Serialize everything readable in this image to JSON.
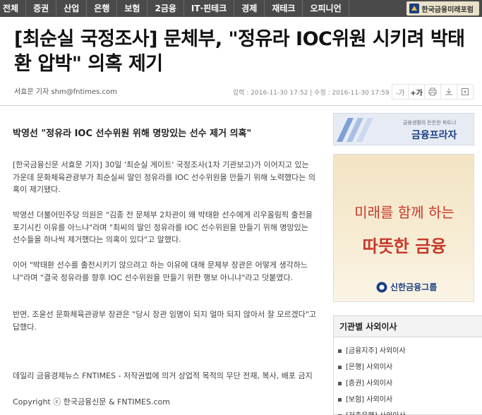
{
  "nav": {
    "items": [
      "전체",
      "증권",
      "산업",
      "은행",
      "보험",
      "2금융",
      "IT·핀테크",
      "경제",
      "재테크",
      "오피니언"
    ],
    "forum_label": "한국금융미래포럼"
  },
  "article": {
    "headline": "[최순실 국정조사] 문체부, \"정유라 IOC위원 시키려 박태환 압박\" 의혹 제기",
    "byline": "서효문 기자 shm@fntimes.com",
    "dates": "입력 : 2016-11-30 17:52  |  수정 : 2016-11-30 17:59",
    "subhead": "박영선 \"정유라 IOC 선수위원 위해 명망있는 선수 제거 의혹\"",
    "paragraphs": [
      "[한국금융신문 서효문 기자] 30일 '최순실 게이트' 국정조사(1차 기관보고)가 이어지고 있는 가운데 문화체육관광부가 최순실씨 딸인 정유라를 IOC 선수위원을 만들기 위해 노력했다는 의혹이 제기됐다.",
      "박영선 더불어민주당 의원은 \"김종 전 문체부 2차관이 왜 박태환 선수에게 리우올림픽 출전을 포기시킨 이유를 아느냐\"라며 \"최씨의 딸인 정유라를 IOC 선수위원을 만들기 위해 명망있는 선수들을 하나씩 제거했다는 의혹이 있다\"고 말했다.",
      "이어 \"박태환 선수를 출전시키기 않으려고 하는 이유에 대해 문체부 장관은 어떻게 생각하느냐\"라며 \"결국 정유라를 향후 IOC 선수위원을 만들기 위한 행보 아니냐\"라고 덧붙였다.",
      "반면, 조윤선 문화체육관광부 장관은 \"당시 장관 임명이 되지 얼마 되지 않아서 잘 모르겠다\"고 답했다."
    ],
    "footer_note": "데일리 금융경제뉴스 FNTIMES - 저작권법에 의거 상업적 목적의 무단 전재, 복사, 배포 금지",
    "copyright": "Copyright ⓒ 한국금융신문 & FNTIMES.com"
  },
  "tools": {
    "font_down": "-가",
    "font_up": "+가"
  },
  "sidebar": {
    "banner1_small": "금융생활의 든든한 파트너",
    "banner1_big": "금융프라자",
    "banner2_line1": "미래를 함께 하는",
    "banner2_line2": "따뜻한 금융",
    "banner2_brand": "신한금융그룹",
    "box_title": "기관별 사외이사",
    "box_items": [
      "[금융지주] 사외이사",
      "[은행] 사외이사",
      "[증권] 사외이사",
      "[보험] 사외이사",
      "[저축은행] 사외이사"
    ]
  }
}
